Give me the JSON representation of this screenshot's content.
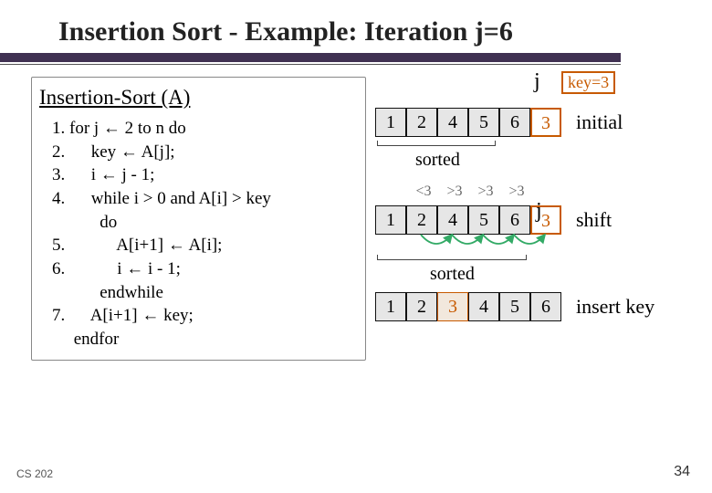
{
  "title": "Insertion Sort - Example: Iteration j=6",
  "algoHead": "Insertion-Sort (A)",
  "code": {
    "l1": "1. for j ← 2 to n do",
    "l2": "2.      key ← A[j];",
    "l3": "3.      i ← j - 1;",
    "l4": "4.      while i > 0 and A[i] > key",
    "l5": "           do",
    "l6": "5.            A[i+1] ← A[i];",
    "l7": "6.            i ← i - 1;",
    "l8": "           endwhile",
    "l9": "7.      A[i+1] ← key;",
    "l10": "     endfor"
  },
  "key_label": "key=3",
  "j_label": "j",
  "rows": {
    "initial": {
      "cells": [
        "1",
        "2",
        "4",
        "5",
        "6",
        "3"
      ],
      "label": "initial",
      "sorted_upto": 5
    },
    "shift": {
      "cells": [
        "1",
        "2",
        "4",
        "5",
        "6",
        "3"
      ],
      "label": "shift",
      "sorted_upto": 5,
      "cmp": [
        "<3",
        ">3",
        ">3",
        ">3"
      ]
    },
    "insert": {
      "cells": [
        "1",
        "2",
        "3",
        "4",
        "5",
        "6"
      ],
      "label": "insert key",
      "sorted_upto": 6
    }
  },
  "sorted_label": "sorted",
  "footer": {
    "left": "CS 202",
    "right": "34"
  }
}
